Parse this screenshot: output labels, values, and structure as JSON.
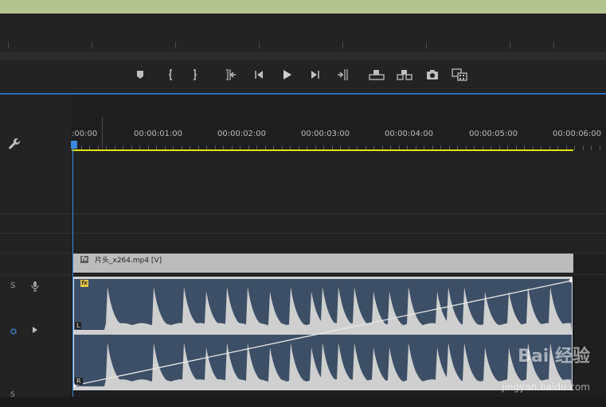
{
  "timeline": {
    "time_labels": [
      ":00:00",
      "00:00:01:00",
      "00:00:02:00",
      "00:00:03:00",
      "00:00:04:00",
      "00:00:05:00",
      "00:00:06:00"
    ]
  },
  "transport": {
    "buttons": [
      {
        "name": "marker-icon"
      },
      {
        "name": "mark-in-icon"
      },
      {
        "name": "mark-out-icon"
      },
      {
        "name": "go-to-in-icon"
      },
      {
        "name": "step-back-icon"
      },
      {
        "name": "play-icon"
      },
      {
        "name": "step-forward-icon"
      },
      {
        "name": "go-to-out-icon"
      },
      {
        "name": "lift-icon"
      },
      {
        "name": "extract-icon"
      },
      {
        "name": "export-frame-icon"
      },
      {
        "name": "compare-icon"
      }
    ]
  },
  "tracks": {
    "audio_solo": "S",
    "audio_mute_icon": "microphone-icon",
    "video_clip_label": "片头_x264.mp4 [V]",
    "video_fx": "fx",
    "audio_fx": "fx",
    "channel_left": "L",
    "channel_right": "R"
  },
  "watermark": {
    "text": "Bai 经验",
    "url": "jingyan.baidu.com"
  },
  "colors": {
    "accent": "#3a8be0",
    "work_area": "#e6e600",
    "waveform_bg": "#3c4f66",
    "waveform": "#cfcfcf"
  }
}
